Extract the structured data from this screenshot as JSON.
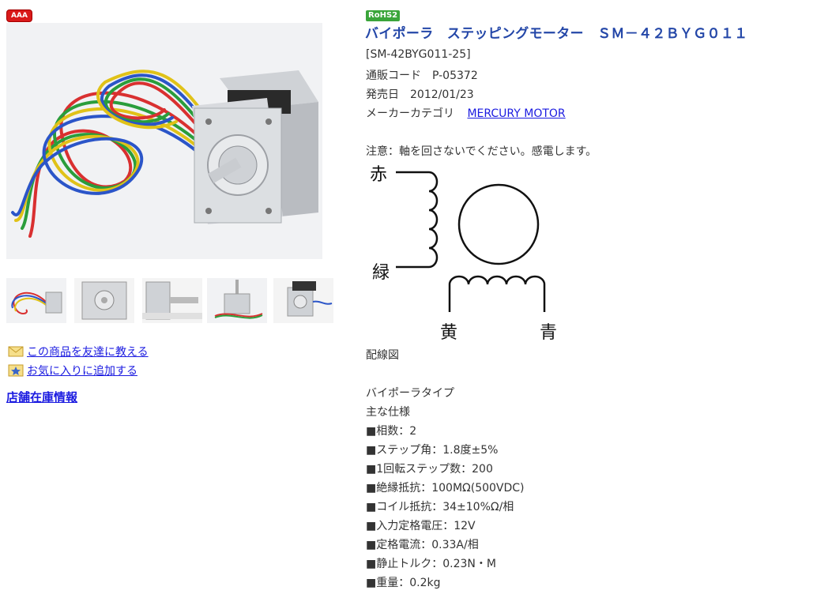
{
  "badge": "AAA",
  "rohs_badge": "RoHS2",
  "product": {
    "title": "バイポーラ　ステッピングモーター　ＳＭ－４２ＢＹＧ０１１",
    "sku": "[SM-42BYG011-25]",
    "mail_code": "通販コード　P-05372",
    "release_date": "発売日　2012/01/23",
    "maker_label": "メーカーカテゴリ",
    "maker_link": "MERCURY MOTOR",
    "caution": "注意：軸を回さないでください。感電します。"
  },
  "diagram": {
    "label_red": "赤",
    "label_green": "緑",
    "label_yellow": "黄",
    "label_blue": "青",
    "caption": "配線図"
  },
  "actions": {
    "tell_friend": "この商品を友達に教える",
    "add_favorite": "お気に入りに追加する"
  },
  "store_stock": "店舗在庫情報",
  "specs": {
    "type": "バイポーラタイプ",
    "heading": "主な仕様",
    "items": [
      "■相数：2",
      "■ステップ角：1.8度±5%",
      "■1回転ステップ数：200",
      "■絶縁抵抗：100MΩ(500VDC)",
      "■コイル抵抗：34±10%Ω/相",
      "■入力定格電圧：12V",
      "■定格電流：0.33A/相",
      "■静止トルク：0.23N・M",
      "■重量：0.2kg"
    ]
  },
  "colors": {
    "title": "#2447a8",
    "link": "#1a1ae0",
    "badge_red": "#d91a1a",
    "rohs_green": "#3aa53a"
  },
  "icons": [
    "envelope-icon",
    "star-favorite-icon"
  ]
}
